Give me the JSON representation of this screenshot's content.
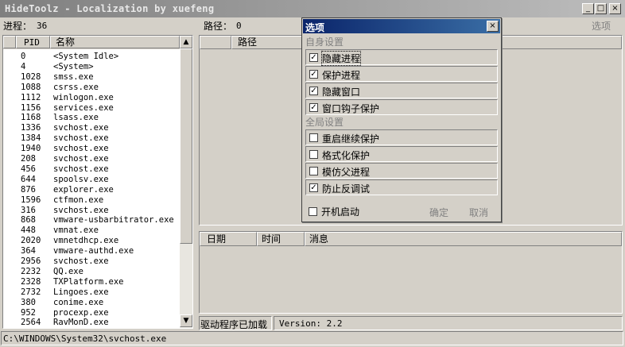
{
  "window": {
    "title": "HideToolz - Localization by xuefeng"
  },
  "top": {
    "process_label": "进程：",
    "process_count": "36",
    "path_label": "路径：",
    "path_value": "0",
    "options_link": "选项"
  },
  "proc_table": {
    "headers": {
      "pid": "PID",
      "name": "名称"
    },
    "rows": [
      {
        "pid": "0",
        "name": "<System Idle>"
      },
      {
        "pid": "4",
        "name": "<System>"
      },
      {
        "pid": "1028",
        "name": "smss.exe"
      },
      {
        "pid": "1088",
        "name": "csrss.exe"
      },
      {
        "pid": "1112",
        "name": "winlogon.exe"
      },
      {
        "pid": "1156",
        "name": "services.exe"
      },
      {
        "pid": "1168",
        "name": "lsass.exe"
      },
      {
        "pid": "1336",
        "name": "svchost.exe"
      },
      {
        "pid": "1384",
        "name": "svchost.exe"
      },
      {
        "pid": "1940",
        "name": "svchost.exe"
      },
      {
        "pid": "208",
        "name": "svchost.exe"
      },
      {
        "pid": "456",
        "name": "svchost.exe"
      },
      {
        "pid": "644",
        "name": "spoolsv.exe"
      },
      {
        "pid": "876",
        "name": "explorer.exe"
      },
      {
        "pid": "1596",
        "name": "ctfmon.exe"
      },
      {
        "pid": "316",
        "name": "svchost.exe"
      },
      {
        "pid": "868",
        "name": "vmware-usbarbitrator.exe"
      },
      {
        "pid": "448",
        "name": "vmnat.exe"
      },
      {
        "pid": "2020",
        "name": "vmnetdhcp.exe"
      },
      {
        "pid": "364",
        "name": "vmware-authd.exe"
      },
      {
        "pid": "2956",
        "name": "svchost.exe"
      },
      {
        "pid": "2232",
        "name": "QQ.exe"
      },
      {
        "pid": "2328",
        "name": "TXPlatform.exe"
      },
      {
        "pid": "2732",
        "name": "Lingoes.exe"
      },
      {
        "pid": "380",
        "name": "conime.exe"
      },
      {
        "pid": "952",
        "name": "procexp.exe"
      },
      {
        "pid": "2564",
        "name": "RavMonD.exe"
      }
    ]
  },
  "path_table": {
    "header": "路径"
  },
  "log_table": {
    "headers": {
      "date": "日期",
      "time": "时间",
      "message": "消息"
    }
  },
  "status": {
    "driver": "驱动程序已加载",
    "version": "Version: 2.2",
    "path": "C:\\WINDOWS\\System32\\svchost.exe"
  },
  "options": {
    "title": "选项",
    "group_self": "自身设置",
    "self_items": [
      {
        "label": "隐藏进程",
        "checked": true
      },
      {
        "label": "保护进程",
        "checked": true
      },
      {
        "label": "隐藏窗口",
        "checked": true
      },
      {
        "label": "窗口钩子保护",
        "checked": true
      }
    ],
    "group_global": "全局设置",
    "global_items": [
      {
        "label": "重启继续保护",
        "checked": false
      },
      {
        "label": "格式化保护",
        "checked": false
      },
      {
        "label": "模仿父进程",
        "checked": false
      },
      {
        "label": "防止反调试",
        "checked": true
      }
    ],
    "autostart": {
      "label": "开机启动",
      "checked": false
    },
    "ok": "确定",
    "cancel": "取消"
  },
  "glyphs": {
    "minimize": "_",
    "maximize": "□",
    "close": "×",
    "scroll_up": "▲",
    "scroll_down": "▼",
    "check": "✓"
  }
}
